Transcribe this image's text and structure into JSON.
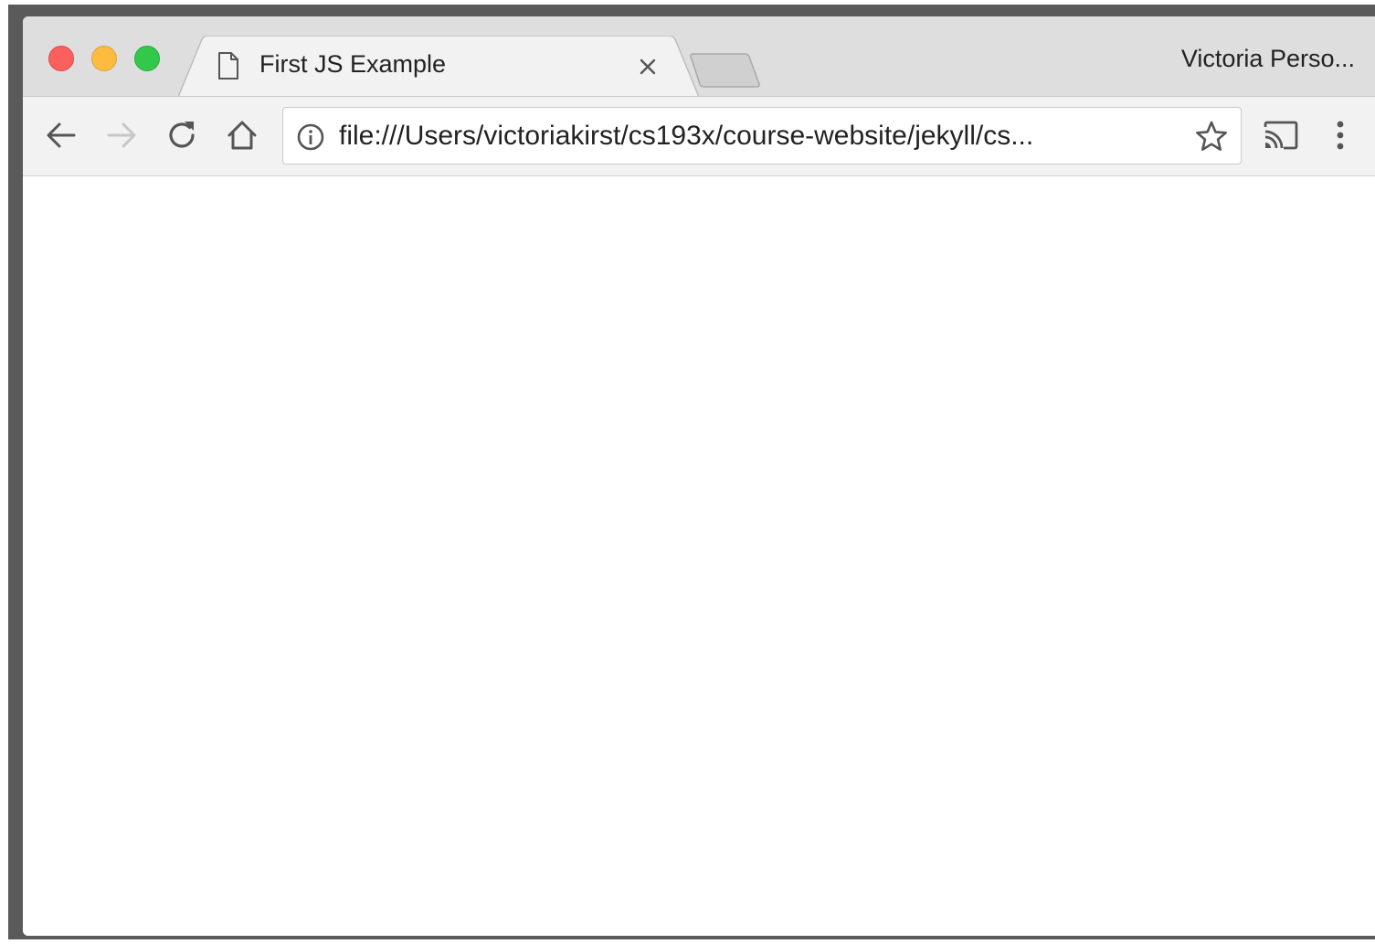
{
  "window": {
    "traffic_colors": {
      "close": "#fc605c",
      "minimize": "#fdbc40",
      "maximize": "#34c84a"
    }
  },
  "tab": {
    "title": "First JS Example",
    "favicon_icon": "page-icon",
    "close_icon": "close-icon"
  },
  "profile": {
    "label": "Victoria Perso..."
  },
  "toolbar": {
    "back_icon": "arrow-left-icon",
    "forward_icon": "arrow-right-icon",
    "reload_icon": "reload-icon",
    "home_icon": "home-icon",
    "cast_icon": "cast-icon",
    "menu_icon": "kebab-menu-icon"
  },
  "omnibox": {
    "info_icon": "info-icon",
    "url": "file:///Users/victoriakirst/cs193x/course-website/jekyll/cs...",
    "star_icon": "star-icon"
  }
}
